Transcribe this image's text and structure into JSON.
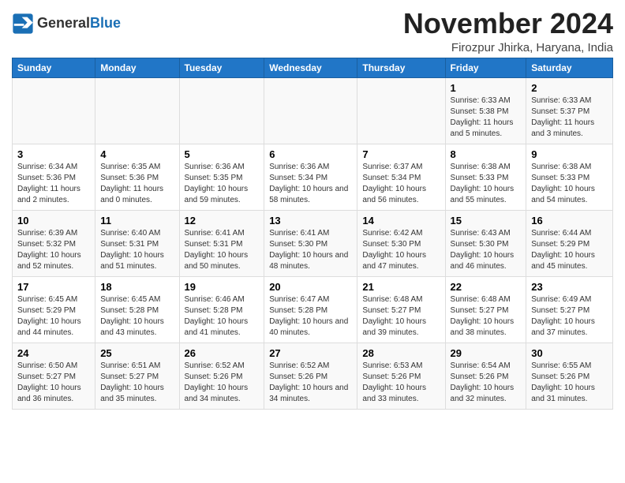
{
  "header": {
    "logo_line1": "General",
    "logo_line2": "Blue",
    "month_title": "November 2024",
    "subtitle": "Firozpur Jhirka, Haryana, India"
  },
  "weekdays": [
    "Sunday",
    "Monday",
    "Tuesday",
    "Wednesday",
    "Thursday",
    "Friday",
    "Saturday"
  ],
  "weeks": [
    [
      {
        "day": "",
        "info": ""
      },
      {
        "day": "",
        "info": ""
      },
      {
        "day": "",
        "info": ""
      },
      {
        "day": "",
        "info": ""
      },
      {
        "day": "",
        "info": ""
      },
      {
        "day": "1",
        "info": "Sunrise: 6:33 AM\nSunset: 5:38 PM\nDaylight: 11 hours and 5 minutes."
      },
      {
        "day": "2",
        "info": "Sunrise: 6:33 AM\nSunset: 5:37 PM\nDaylight: 11 hours and 3 minutes."
      }
    ],
    [
      {
        "day": "3",
        "info": "Sunrise: 6:34 AM\nSunset: 5:36 PM\nDaylight: 11 hours and 2 minutes."
      },
      {
        "day": "4",
        "info": "Sunrise: 6:35 AM\nSunset: 5:36 PM\nDaylight: 11 hours and 0 minutes."
      },
      {
        "day": "5",
        "info": "Sunrise: 6:36 AM\nSunset: 5:35 PM\nDaylight: 10 hours and 59 minutes."
      },
      {
        "day": "6",
        "info": "Sunrise: 6:36 AM\nSunset: 5:34 PM\nDaylight: 10 hours and 58 minutes."
      },
      {
        "day": "7",
        "info": "Sunrise: 6:37 AM\nSunset: 5:34 PM\nDaylight: 10 hours and 56 minutes."
      },
      {
        "day": "8",
        "info": "Sunrise: 6:38 AM\nSunset: 5:33 PM\nDaylight: 10 hours and 55 minutes."
      },
      {
        "day": "9",
        "info": "Sunrise: 6:38 AM\nSunset: 5:33 PM\nDaylight: 10 hours and 54 minutes."
      }
    ],
    [
      {
        "day": "10",
        "info": "Sunrise: 6:39 AM\nSunset: 5:32 PM\nDaylight: 10 hours and 52 minutes."
      },
      {
        "day": "11",
        "info": "Sunrise: 6:40 AM\nSunset: 5:31 PM\nDaylight: 10 hours and 51 minutes."
      },
      {
        "day": "12",
        "info": "Sunrise: 6:41 AM\nSunset: 5:31 PM\nDaylight: 10 hours and 50 minutes."
      },
      {
        "day": "13",
        "info": "Sunrise: 6:41 AM\nSunset: 5:30 PM\nDaylight: 10 hours and 48 minutes."
      },
      {
        "day": "14",
        "info": "Sunrise: 6:42 AM\nSunset: 5:30 PM\nDaylight: 10 hours and 47 minutes."
      },
      {
        "day": "15",
        "info": "Sunrise: 6:43 AM\nSunset: 5:30 PM\nDaylight: 10 hours and 46 minutes."
      },
      {
        "day": "16",
        "info": "Sunrise: 6:44 AM\nSunset: 5:29 PM\nDaylight: 10 hours and 45 minutes."
      }
    ],
    [
      {
        "day": "17",
        "info": "Sunrise: 6:45 AM\nSunset: 5:29 PM\nDaylight: 10 hours and 44 minutes."
      },
      {
        "day": "18",
        "info": "Sunrise: 6:45 AM\nSunset: 5:28 PM\nDaylight: 10 hours and 43 minutes."
      },
      {
        "day": "19",
        "info": "Sunrise: 6:46 AM\nSunset: 5:28 PM\nDaylight: 10 hours and 41 minutes."
      },
      {
        "day": "20",
        "info": "Sunrise: 6:47 AM\nSunset: 5:28 PM\nDaylight: 10 hours and 40 minutes."
      },
      {
        "day": "21",
        "info": "Sunrise: 6:48 AM\nSunset: 5:27 PM\nDaylight: 10 hours and 39 minutes."
      },
      {
        "day": "22",
        "info": "Sunrise: 6:48 AM\nSunset: 5:27 PM\nDaylight: 10 hours and 38 minutes."
      },
      {
        "day": "23",
        "info": "Sunrise: 6:49 AM\nSunset: 5:27 PM\nDaylight: 10 hours and 37 minutes."
      }
    ],
    [
      {
        "day": "24",
        "info": "Sunrise: 6:50 AM\nSunset: 5:27 PM\nDaylight: 10 hours and 36 minutes."
      },
      {
        "day": "25",
        "info": "Sunrise: 6:51 AM\nSunset: 5:27 PM\nDaylight: 10 hours and 35 minutes."
      },
      {
        "day": "26",
        "info": "Sunrise: 6:52 AM\nSunset: 5:26 PM\nDaylight: 10 hours and 34 minutes."
      },
      {
        "day": "27",
        "info": "Sunrise: 6:52 AM\nSunset: 5:26 PM\nDaylight: 10 hours and 34 minutes."
      },
      {
        "day": "28",
        "info": "Sunrise: 6:53 AM\nSunset: 5:26 PM\nDaylight: 10 hours and 33 minutes."
      },
      {
        "day": "29",
        "info": "Sunrise: 6:54 AM\nSunset: 5:26 PM\nDaylight: 10 hours and 32 minutes."
      },
      {
        "day": "30",
        "info": "Sunrise: 6:55 AM\nSunset: 5:26 PM\nDaylight: 10 hours and 31 minutes."
      }
    ]
  ]
}
